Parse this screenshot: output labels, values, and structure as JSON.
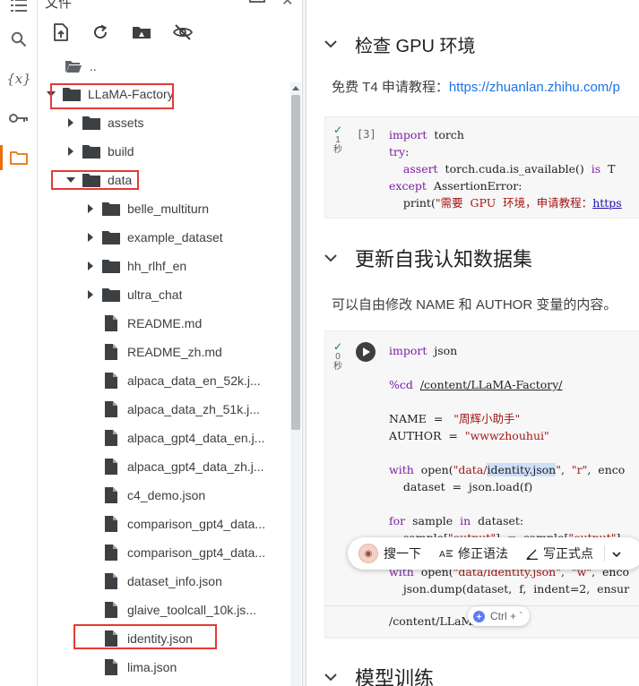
{
  "rail": {
    "icons": [
      "list-icon",
      "search-icon",
      "variables-icon",
      "key-icon",
      "folder-icon"
    ],
    "variables_glyph": "{x}",
    "active": "folder-icon",
    "accent": "#e8710a"
  },
  "file_panel": {
    "title": "文件",
    "toolbar": [
      "upload-icon",
      "refresh-icon",
      "drive-icon",
      "hide-icon"
    ],
    "parent_label": "..",
    "tree": [
      {
        "label": "LLaMA-Factory",
        "type": "folder",
        "expanded": true,
        "depth": 0,
        "highlighted": true
      },
      {
        "label": "assets",
        "type": "folder",
        "expanded": false,
        "depth": 1
      },
      {
        "label": "build",
        "type": "folder",
        "expanded": false,
        "depth": 1
      },
      {
        "label": "data",
        "type": "folder",
        "expanded": true,
        "depth": 1,
        "highlighted": true
      },
      {
        "label": "belle_multiturn",
        "type": "folder",
        "expanded": false,
        "depth": 2
      },
      {
        "label": "example_dataset",
        "type": "folder",
        "expanded": false,
        "depth": 2
      },
      {
        "label": "hh_rlhf_en",
        "type": "folder",
        "expanded": false,
        "depth": 2
      },
      {
        "label": "ultra_chat",
        "type": "folder",
        "expanded": false,
        "depth": 2
      },
      {
        "label": "README.md",
        "type": "file",
        "depth": 2
      },
      {
        "label": "README_zh.md",
        "type": "file",
        "depth": 2
      },
      {
        "label": "alpaca_data_en_52k.j...",
        "type": "file",
        "depth": 2
      },
      {
        "label": "alpaca_data_zh_51k.j...",
        "type": "file",
        "depth": 2
      },
      {
        "label": "alpaca_gpt4_data_en.j...",
        "type": "file",
        "depth": 2
      },
      {
        "label": "alpaca_gpt4_data_zh.j...",
        "type": "file",
        "depth": 2
      },
      {
        "label": "c4_demo.json",
        "type": "file",
        "depth": 2
      },
      {
        "label": "comparison_gpt4_data...",
        "type": "file",
        "depth": 2
      },
      {
        "label": "comparison_gpt4_data...",
        "type": "file",
        "depth": 2
      },
      {
        "label": "dataset_info.json",
        "type": "file",
        "depth": 2
      },
      {
        "label": "glaive_toolcall_10k.js...",
        "type": "file",
        "depth": 2
      },
      {
        "label": "identity.json",
        "type": "file",
        "depth": 2,
        "highlighted": true
      },
      {
        "label": "lima.json",
        "type": "file",
        "depth": 2
      }
    ],
    "highlight_color": "#e53935"
  },
  "notebook": {
    "section1": {
      "heading": "检查 GPU 环境",
      "text_prefix": "免费 T4 申请教程：",
      "link": "https://zhuanlan.zhihu.com/p",
      "cell": {
        "prompt": "[3]",
        "exec_line1": "1",
        "exec_line2": "秒",
        "code": [
          [
            "kw:import",
            "t:  torch"
          ],
          [
            "kw:try",
            "t::"
          ],
          [
            "t:    ",
            "kw:assert",
            "t:  torch.cuda.is_available()  ",
            "kw:is",
            "t:  T"
          ],
          [
            "kw:except",
            "t:  AssertionError:"
          ],
          [
            "t:    print(",
            "st:\"需要  GPU  环境，申请教程：",
            "lnk:https"
          ]
        ]
      }
    },
    "section2": {
      "heading": "更新自我认知数据集",
      "text": "可以自由修改 NAME 和 AUTHOR 变量的内容。",
      "cell": {
        "exec_line1": "0",
        "exec_line2": "秒",
        "code": [
          [
            "kw:import",
            "t:  json"
          ],
          [],
          [
            "kw:%cd",
            "t:  ",
            "u:/content/LLaMA-Factory/"
          ],
          [],
          [
            "t:NAME  =   ",
            "st:\"周辉小助手\""
          ],
          [
            "t:AUTHOR  =  ",
            "st:\"wwwzhouhui\""
          ],
          [],
          [
            "kw:with",
            "t:  open(",
            "st:\"data/",
            "sel:identity.json",
            "st:\"",
            "t:,  ",
            "st:\"r\"",
            "t:,  enco"
          ],
          [
            "t:    dataset  =  json.load(f)"
          ],
          [],
          [
            "kw:for",
            "t:  sample  ",
            "kw:in",
            "t:  dataset:"
          ],
          [
            "t:    sample[",
            "st:\"output\"",
            "t:]  =  sample[",
            "st:\"output\"",
            "t:]."
          ],
          [],
          [
            "kw:with",
            "t:  open(",
            "st:\"data/identity.json\"",
            "t:,  ",
            "st:\"w\"",
            "t:,  enco"
          ],
          [
            "t:    json.dump(dataset,  f,  indent=2,  ensur"
          ]
        ],
        "output": "/content/LLaMA-F"
      }
    },
    "section3": {
      "heading": "模型训练"
    }
  },
  "floating_toolbar": {
    "items": [
      "搜一下",
      "修正语法",
      "写正式点"
    ],
    "more": "more-chevron-icon"
  },
  "ctrl_pill": {
    "label": "Ctrl + `"
  }
}
